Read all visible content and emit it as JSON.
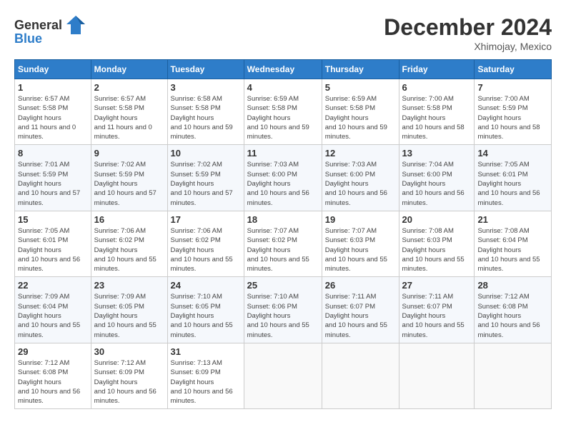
{
  "logo": {
    "text_general": "General",
    "text_blue": "Blue"
  },
  "title": "December 2024",
  "location": "Xhimojay, Mexico",
  "days_of_week": [
    "Sunday",
    "Monday",
    "Tuesday",
    "Wednesday",
    "Thursday",
    "Friday",
    "Saturday"
  ],
  "weeks": [
    [
      {
        "day": "1",
        "sunrise": "6:57 AM",
        "sunset": "5:58 PM",
        "daylight": "11 hours and 0 minutes."
      },
      {
        "day": "2",
        "sunrise": "6:57 AM",
        "sunset": "5:58 PM",
        "daylight": "11 hours and 0 minutes."
      },
      {
        "day": "3",
        "sunrise": "6:58 AM",
        "sunset": "5:58 PM",
        "daylight": "10 hours and 59 minutes."
      },
      {
        "day": "4",
        "sunrise": "6:59 AM",
        "sunset": "5:58 PM",
        "daylight": "10 hours and 59 minutes."
      },
      {
        "day": "5",
        "sunrise": "6:59 AM",
        "sunset": "5:58 PM",
        "daylight": "10 hours and 59 minutes."
      },
      {
        "day": "6",
        "sunrise": "7:00 AM",
        "sunset": "5:58 PM",
        "daylight": "10 hours and 58 minutes."
      },
      {
        "day": "7",
        "sunrise": "7:00 AM",
        "sunset": "5:59 PM",
        "daylight": "10 hours and 58 minutes."
      }
    ],
    [
      {
        "day": "8",
        "sunrise": "7:01 AM",
        "sunset": "5:59 PM",
        "daylight": "10 hours and 57 minutes."
      },
      {
        "day": "9",
        "sunrise": "7:02 AM",
        "sunset": "5:59 PM",
        "daylight": "10 hours and 57 minutes."
      },
      {
        "day": "10",
        "sunrise": "7:02 AM",
        "sunset": "5:59 PM",
        "daylight": "10 hours and 57 minutes."
      },
      {
        "day": "11",
        "sunrise": "7:03 AM",
        "sunset": "6:00 PM",
        "daylight": "10 hours and 56 minutes."
      },
      {
        "day": "12",
        "sunrise": "7:03 AM",
        "sunset": "6:00 PM",
        "daylight": "10 hours and 56 minutes."
      },
      {
        "day": "13",
        "sunrise": "7:04 AM",
        "sunset": "6:00 PM",
        "daylight": "10 hours and 56 minutes."
      },
      {
        "day": "14",
        "sunrise": "7:05 AM",
        "sunset": "6:01 PM",
        "daylight": "10 hours and 56 minutes."
      }
    ],
    [
      {
        "day": "15",
        "sunrise": "7:05 AM",
        "sunset": "6:01 PM",
        "daylight": "10 hours and 56 minutes."
      },
      {
        "day": "16",
        "sunrise": "7:06 AM",
        "sunset": "6:02 PM",
        "daylight": "10 hours and 55 minutes."
      },
      {
        "day": "17",
        "sunrise": "7:06 AM",
        "sunset": "6:02 PM",
        "daylight": "10 hours and 55 minutes."
      },
      {
        "day": "18",
        "sunrise": "7:07 AM",
        "sunset": "6:02 PM",
        "daylight": "10 hours and 55 minutes."
      },
      {
        "day": "19",
        "sunrise": "7:07 AM",
        "sunset": "6:03 PM",
        "daylight": "10 hours and 55 minutes."
      },
      {
        "day": "20",
        "sunrise": "7:08 AM",
        "sunset": "6:03 PM",
        "daylight": "10 hours and 55 minutes."
      },
      {
        "day": "21",
        "sunrise": "7:08 AM",
        "sunset": "6:04 PM",
        "daylight": "10 hours and 55 minutes."
      }
    ],
    [
      {
        "day": "22",
        "sunrise": "7:09 AM",
        "sunset": "6:04 PM",
        "daylight": "10 hours and 55 minutes."
      },
      {
        "day": "23",
        "sunrise": "7:09 AM",
        "sunset": "6:05 PM",
        "daylight": "10 hours and 55 minutes."
      },
      {
        "day": "24",
        "sunrise": "7:10 AM",
        "sunset": "6:05 PM",
        "daylight": "10 hours and 55 minutes."
      },
      {
        "day": "25",
        "sunrise": "7:10 AM",
        "sunset": "6:06 PM",
        "daylight": "10 hours and 55 minutes."
      },
      {
        "day": "26",
        "sunrise": "7:11 AM",
        "sunset": "6:07 PM",
        "daylight": "10 hours and 55 minutes."
      },
      {
        "day": "27",
        "sunrise": "7:11 AM",
        "sunset": "6:07 PM",
        "daylight": "10 hours and 55 minutes."
      },
      {
        "day": "28",
        "sunrise": "7:12 AM",
        "sunset": "6:08 PM",
        "daylight": "10 hours and 56 minutes."
      }
    ],
    [
      {
        "day": "29",
        "sunrise": "7:12 AM",
        "sunset": "6:08 PM",
        "daylight": "10 hours and 56 minutes."
      },
      {
        "day": "30",
        "sunrise": "7:12 AM",
        "sunset": "6:09 PM",
        "daylight": "10 hours and 56 minutes."
      },
      {
        "day": "31",
        "sunrise": "7:13 AM",
        "sunset": "6:09 PM",
        "daylight": "10 hours and 56 minutes."
      },
      null,
      null,
      null,
      null
    ]
  ],
  "labels": {
    "sunrise": "Sunrise: ",
    "sunset": "Sunset: ",
    "daylight": "Daylight hours"
  }
}
